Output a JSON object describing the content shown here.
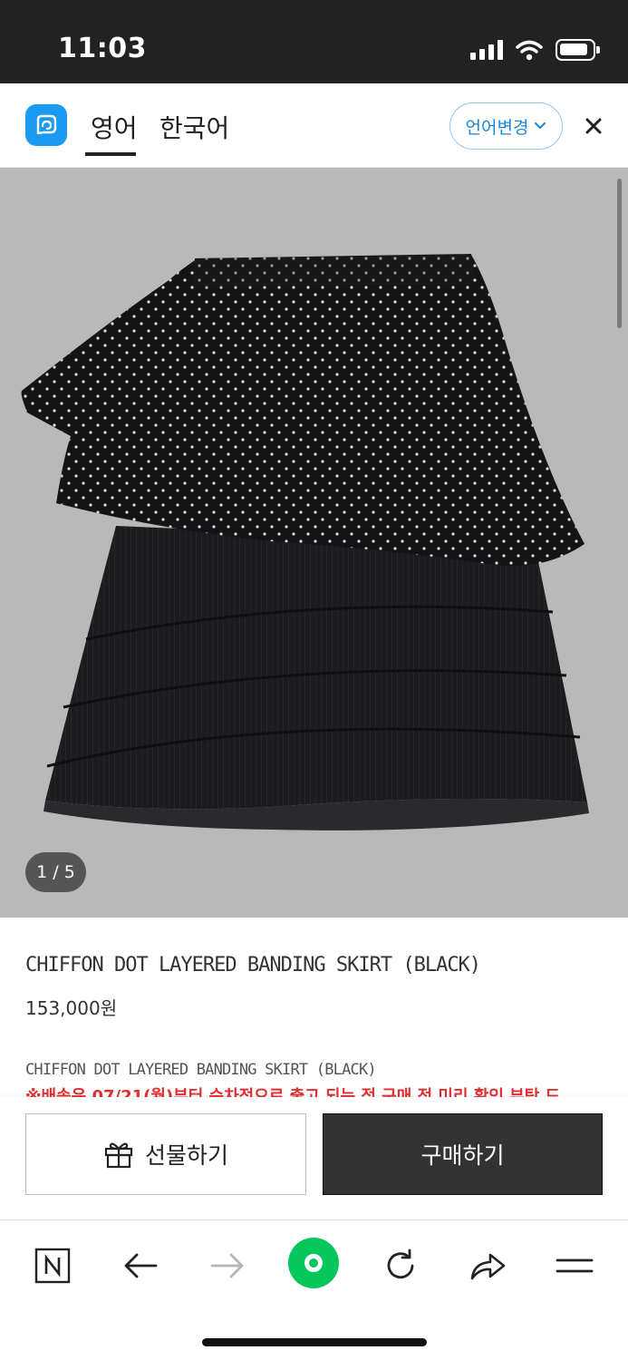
{
  "status_bar": {
    "time": "11:03"
  },
  "translate_bar": {
    "tabs": [
      {
        "label": "영어",
        "active": true
      },
      {
        "label": "한국어",
        "active": false
      }
    ],
    "change_language_label": "언어변경"
  },
  "gallery": {
    "counter": "1 / 5"
  },
  "product": {
    "name": "CHIFFON DOT LAYERED BANDING SKIRT (BLACK)",
    "price": "153,000원",
    "desc_title": "CHIFFON DOT LAYERED BANDING SKIRT (BLACK)",
    "desc_notice": "※배송은 07/21(월)부터 순차적으로 출고 되는 점 구매 전 미리 확인 부탁 드"
  },
  "actions": {
    "gift_label": "선물하기",
    "buy_label": "구매하기"
  },
  "browser_toolbar": {
    "items": [
      "naver-home-icon",
      "back-arrow-icon",
      "forward-arrow-icon",
      "green-dot-icon",
      "refresh-icon",
      "share-icon",
      "menu-icon"
    ]
  },
  "colors": {
    "brand_blue": "#1a9af0",
    "buy_button": "#333333",
    "notice_red": "#e23030",
    "naver_green": "#03c75a"
  }
}
